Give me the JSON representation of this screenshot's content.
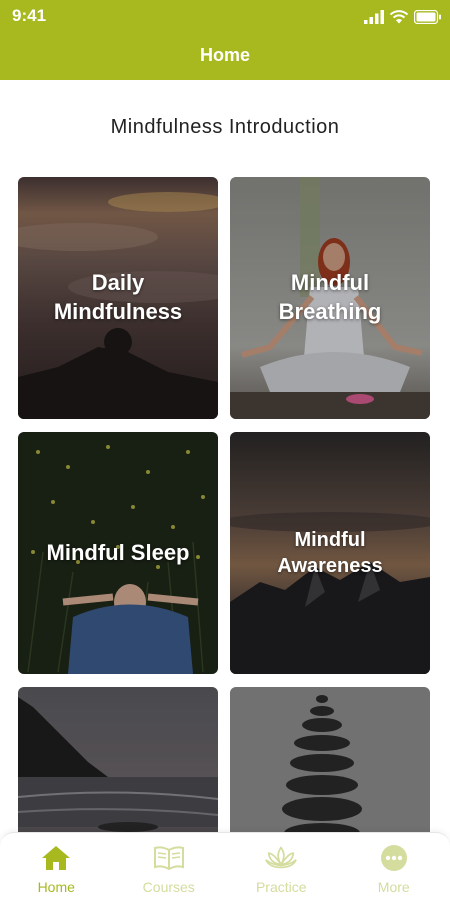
{
  "status_bar": {
    "time": "9:41"
  },
  "header": {
    "title": "Home"
  },
  "section": {
    "title": "Mindfulness Introduction"
  },
  "cards": [
    {
      "line1": "Daily",
      "line2": "Mindfulness"
    },
    {
      "line1": "Mindful",
      "line2": "Breathing"
    },
    {
      "line1": "Mindful Sleep",
      "line2": ""
    },
    {
      "line1": "Mindful",
      "line2": "Awareness"
    },
    {
      "line1": "",
      "line2": ""
    },
    {
      "line1": "",
      "line2": ""
    }
  ],
  "tabbar": {
    "items": [
      {
        "label": "Home",
        "icon": "home-icon",
        "active": true
      },
      {
        "label": "Courses",
        "icon": "book-icon",
        "active": false
      },
      {
        "label": "Practice",
        "icon": "lotus-icon",
        "active": false
      },
      {
        "label": "More",
        "icon": "more-dots-icon",
        "active": false
      }
    ]
  },
  "colors": {
    "accent": "#a8b920",
    "inactive_tab": "#d4dc9e"
  }
}
